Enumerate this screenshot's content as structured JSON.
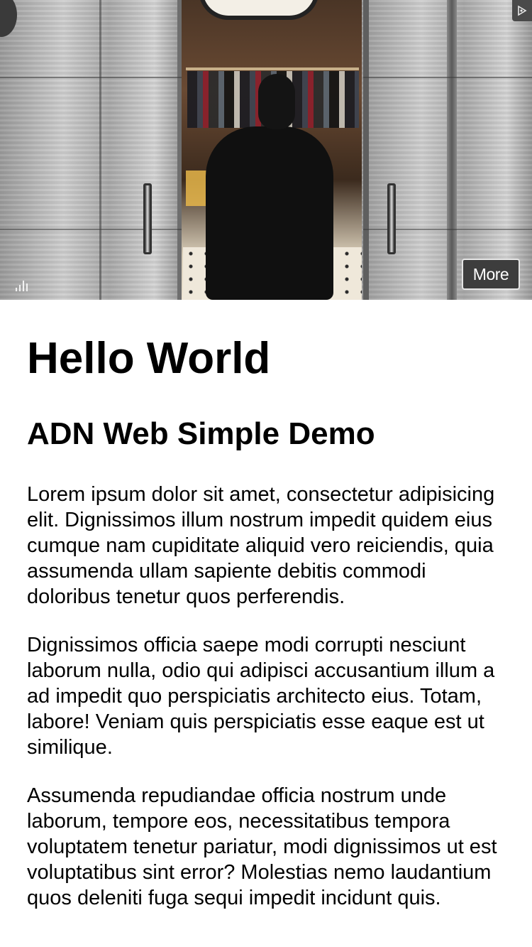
{
  "ad": {
    "more_label": "More",
    "ad_choices_icon": "ad-choices-icon",
    "volume_icon": "volume-bars-icon"
  },
  "article": {
    "title": "Hello World",
    "subtitle": "ADN Web Simple Demo",
    "paragraphs": [
      "Lorem ipsum dolor sit amet, consectetur adipisicing elit. Dignissimos illum nostrum impedit quidem eius cumque nam cupiditate aliquid vero reiciendis, quia assumenda ullam sapiente debitis commodi doloribus tenetur quos perferendis.",
      "Dignissimos officia saepe modi corrupti nesciunt laborum nulla, odio qui adipisci accusantium illum a ad impedit quo perspiciatis architecto eius. Totam, labore! Veniam quis perspiciatis esse eaque est ut similique.",
      "Assumenda repudiandae officia nostrum unde laborum, tempore eos, necessitatibus tempora voluptatem tenetur pariatur, modi dignissimos ut est voluptatibus sint error? Molestias nemo laudantium quos deleniti fuga sequi impedit incidunt quis."
    ]
  }
}
